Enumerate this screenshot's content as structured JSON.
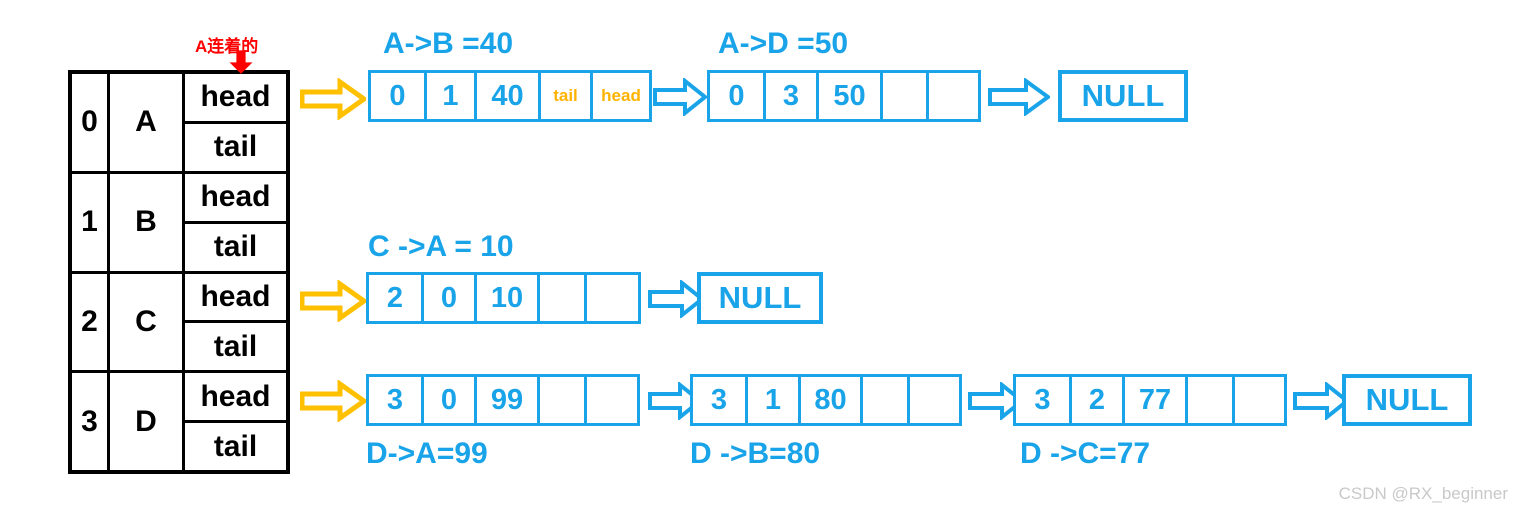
{
  "watermark": "CSDN @RX_beginner",
  "annotation": {
    "text": "A连着的",
    "color": "#ff0000",
    "icon": "down-arrow-icon"
  },
  "colors": {
    "blue": "#19a3e8",
    "orange": "#ffb300",
    "red": "#ff0000",
    "black": "#000000",
    "watermark": "#c9c9c9"
  },
  "adjacency_table": {
    "rows": [
      {
        "index": "0",
        "vertex": "A",
        "head_label": "head",
        "tail_label": "tail"
      },
      {
        "index": "1",
        "vertex": "B",
        "head_label": "head",
        "tail_label": "tail"
      },
      {
        "index": "2",
        "vertex": "C",
        "head_label": "head",
        "tail_label": "tail"
      },
      {
        "index": "3",
        "vertex": "D",
        "head_label": "head",
        "tail_label": "tail"
      }
    ]
  },
  "lists": {
    "a": {
      "label_1": "A->B =40",
      "label_2": "A->D =50",
      "node1": {
        "c1": "0",
        "c2": "1",
        "c3": "40",
        "c4": "tail",
        "c5": "head"
      },
      "node2": {
        "c1": "0",
        "c2": "3",
        "c3": "50",
        "c4": "",
        "c5": ""
      },
      "null": "NULL"
    },
    "c": {
      "label_1": "C ->A = 10",
      "node1": {
        "c1": "2",
        "c2": "0",
        "c3": "10",
        "c4": "",
        "c5": ""
      },
      "null": "NULL"
    },
    "d": {
      "label_1": "D->A=99",
      "label_2": "D ->B=80",
      "label_3": "D ->C=77",
      "node1": {
        "c1": "3",
        "c2": "0",
        "c3": "99",
        "c4": "",
        "c5": ""
      },
      "node2": {
        "c1": "3",
        "c2": "1",
        "c3": "80",
        "c4": "",
        "c5": ""
      },
      "node3": {
        "c1": "3",
        "c2": "2",
        "c3": "77",
        "c4": "",
        "c5": ""
      },
      "null": "NULL"
    }
  }
}
